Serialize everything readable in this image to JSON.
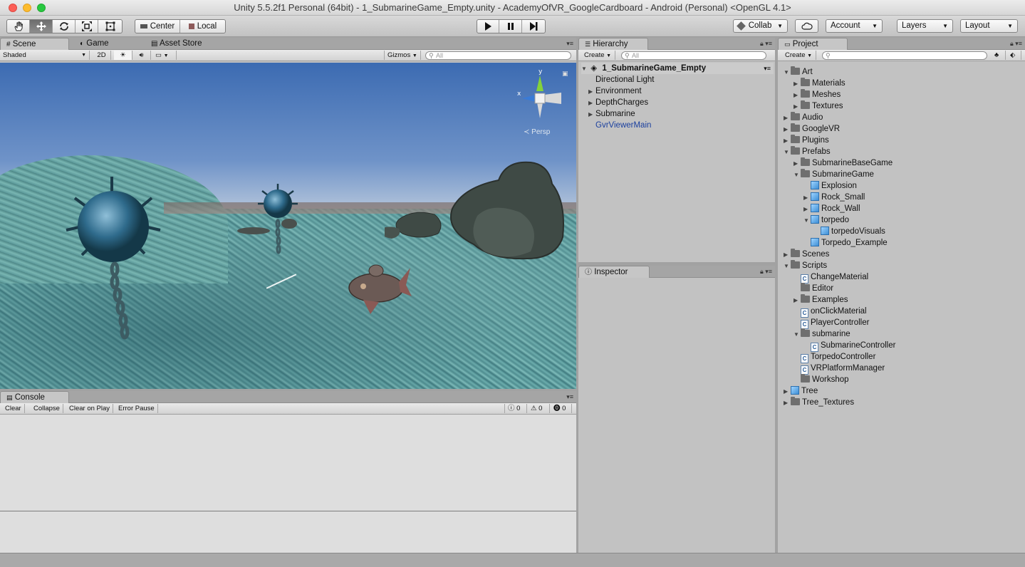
{
  "window": {
    "title": "Unity 5.5.2f1 Personal (64bit) - 1_SubmarineGame_Empty.unity - AcademyOfVR_GoogleCardboard - Android (Personal) <OpenGL 4.1>"
  },
  "toolbar": {
    "transform_tools": [
      "hand-tool",
      "move-tool",
      "rotate-tool",
      "scale-tool",
      "rect-tool"
    ],
    "pivot_label": "Center",
    "space_label": "Local",
    "play_controls": [
      "play",
      "pause",
      "step"
    ],
    "collab_label": "Collab",
    "account_label": "Account",
    "layers_label": "Layers",
    "layout_label": "Layout"
  },
  "scene_panel": {
    "tabs": [
      "Scene",
      "Game",
      "Asset Store"
    ],
    "shading_mode": "Shaded",
    "mode_2d": "2D",
    "gizmos_label": "Gizmos",
    "search_placeholder": "All",
    "gizmo_axis_y": "y",
    "gizmo_axis_x": "x",
    "persp_label": "Persp"
  },
  "console_panel": {
    "tab": "Console",
    "buttons": [
      "Clear",
      "Collapse",
      "Clear on Play",
      "Error Pause"
    ],
    "info_count": "0",
    "warning_count": "0",
    "error_count": "0"
  },
  "hierarchy_panel": {
    "tab": "Hierarchy",
    "create_label": "Create",
    "search_placeholder": "All",
    "scene_name": "1_SubmarineGame_Empty",
    "items": [
      {
        "label": "Directional Light",
        "expandable": false
      },
      {
        "label": "Environment",
        "expandable": true
      },
      {
        "label": "DepthCharges",
        "expandable": true
      },
      {
        "label": "Submarine",
        "expandable": true
      },
      {
        "label": "GvrViewerMain",
        "expandable": false,
        "highlight_color": "#1a3f9e"
      }
    ]
  },
  "inspector_panel": {
    "tab": "Inspector"
  },
  "project_panel": {
    "tab": "Project",
    "create_label": "Create",
    "tree": [
      {
        "label": "Art",
        "depth": 0,
        "icon": "folder",
        "arrow": "open"
      },
      {
        "label": "Materials",
        "depth": 1,
        "icon": "folder",
        "arrow": "closed"
      },
      {
        "label": "Meshes",
        "depth": 1,
        "icon": "folder",
        "arrow": "closed"
      },
      {
        "label": "Textures",
        "depth": 1,
        "icon": "folder",
        "arrow": "closed"
      },
      {
        "label": "Audio",
        "depth": 0,
        "icon": "folder",
        "arrow": "closed"
      },
      {
        "label": "GoogleVR",
        "depth": 0,
        "icon": "folder",
        "arrow": "closed"
      },
      {
        "label": "Plugins",
        "depth": 0,
        "icon": "folder",
        "arrow": "closed"
      },
      {
        "label": "Prefabs",
        "depth": 0,
        "icon": "folder",
        "arrow": "open"
      },
      {
        "label": "SubmarineBaseGame",
        "depth": 1,
        "icon": "folder",
        "arrow": "closed"
      },
      {
        "label": "SubmarineGame",
        "depth": 1,
        "icon": "folder",
        "arrow": "open"
      },
      {
        "label": "Explosion",
        "depth": 2,
        "icon": "cube",
        "arrow": "none"
      },
      {
        "label": "Rock_Small",
        "depth": 2,
        "icon": "cube",
        "arrow": "closed"
      },
      {
        "label": "Rock_Wall",
        "depth": 2,
        "icon": "cube",
        "arrow": "closed"
      },
      {
        "label": "torpedo",
        "depth": 2,
        "icon": "cube",
        "arrow": "open"
      },
      {
        "label": "torpedoVisuals",
        "depth": 3,
        "icon": "cube",
        "arrow": "none"
      },
      {
        "label": "Torpedo_Example",
        "depth": 2,
        "icon": "cube",
        "arrow": "none"
      },
      {
        "label": "Scenes",
        "depth": 0,
        "icon": "folder",
        "arrow": "closed"
      },
      {
        "label": "Scripts",
        "depth": 0,
        "icon": "folder",
        "arrow": "open"
      },
      {
        "label": "ChangeMaterial",
        "depth": 1,
        "icon": "script",
        "arrow": "none"
      },
      {
        "label": "Editor",
        "depth": 1,
        "icon": "folder",
        "arrow": "none"
      },
      {
        "label": "Examples",
        "depth": 1,
        "icon": "folder",
        "arrow": "closed"
      },
      {
        "label": "onClickMaterial",
        "depth": 1,
        "icon": "script",
        "arrow": "none"
      },
      {
        "label": "PlayerController",
        "depth": 1,
        "icon": "script",
        "arrow": "none"
      },
      {
        "label": "submarine",
        "depth": 1,
        "icon": "folder",
        "arrow": "open"
      },
      {
        "label": "SubmarineController",
        "depth": 2,
        "icon": "script",
        "arrow": "none"
      },
      {
        "label": "TorpedoController",
        "depth": 1,
        "icon": "script",
        "arrow": "none"
      },
      {
        "label": "VRPlatformManager",
        "depth": 1,
        "icon": "script",
        "arrow": "none"
      },
      {
        "label": "Workshop",
        "depth": 1,
        "icon": "folder",
        "arrow": "none"
      },
      {
        "label": "Tree",
        "depth": 0,
        "icon": "cube",
        "arrow": "closed"
      },
      {
        "label": "Tree_Textures",
        "depth": 0,
        "icon": "folder",
        "arrow": "closed"
      }
    ]
  }
}
